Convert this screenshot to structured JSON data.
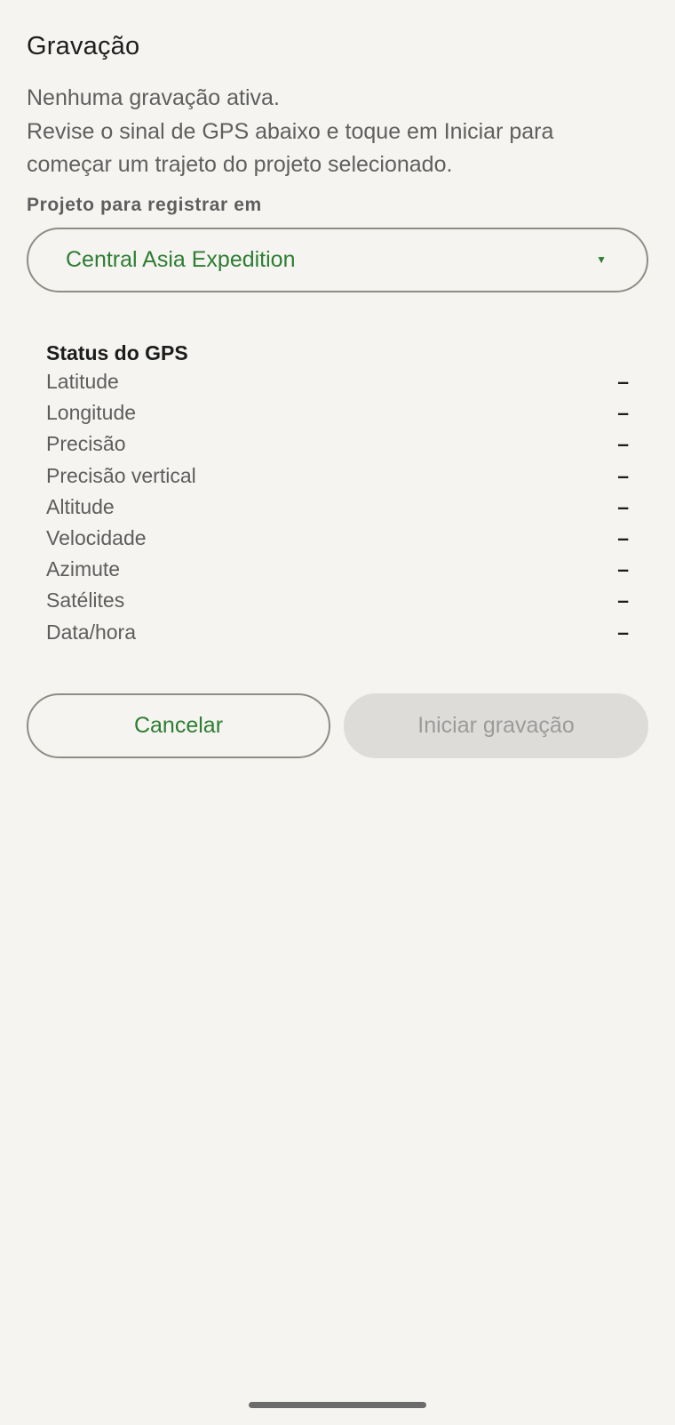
{
  "screen": {
    "title": "Gravação",
    "intro_lines": [
      "Nenhuma gravação ativa.",
      "Revise o sinal de GPS abaixo e toque em Iniciar para",
      "começar um trajeto do projeto selecionado."
    ]
  },
  "project": {
    "label": "Projeto para registrar em",
    "selected": "Central Asia Expedition",
    "caret_icon": "dropdown-triangle-icon"
  },
  "gps": {
    "title": "Status do GPS",
    "rows": [
      {
        "label": "Latitude",
        "value": "–"
      },
      {
        "label": "Longitude",
        "value": "–"
      },
      {
        "label": "Precisão",
        "value": "–"
      },
      {
        "label": "Precisão vertical",
        "value": "–"
      },
      {
        "label": "Altitude",
        "value": "–"
      },
      {
        "label": "Velocidade",
        "value": "–"
      },
      {
        "label": "Azimute",
        "value": "–"
      },
      {
        "label": "Satélites",
        "value": "–"
      },
      {
        "label": "Data/hora",
        "value": "–"
      }
    ]
  },
  "actions": {
    "cancel_label": "Cancelar",
    "start_label": "Iniciar gravação",
    "start_enabled": false
  },
  "colors": {
    "background": "#f5f4f1",
    "accent": "#2e7d32",
    "disabled_bg": "#dddcd9",
    "disabled_text": "#9b9b9b"
  }
}
